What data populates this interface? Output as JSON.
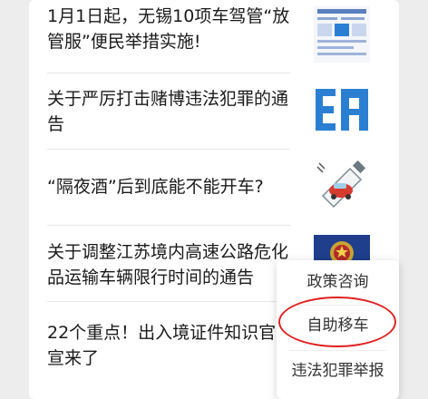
{
  "articles": [
    {
      "title": "1月1日起，无锡10项车驾管“放管服”便民举措实施!",
      "thumb": "doc-thumbnail"
    },
    {
      "title": "关于严厉打击赌博违法犯罪的通告",
      "thumb": "notice-thumbnail"
    },
    {
      "title": "“隔夜酒”后到底能不能开车?",
      "thumb": "car-cartoon-thumbnail"
    },
    {
      "title": "关于调整江苏境内高速公路危化品运输车辆限行时间的通告",
      "thumb": "police-badge-thumbnail"
    },
    {
      "title": "22个重点！出入境证件知识官宣来了",
      "thumb": ""
    }
  ],
  "menu": {
    "items": [
      "政策咨询",
      "自助移车",
      "违法犯罪举报"
    ],
    "highlighted_index": 1
  },
  "colors": {
    "highlight_circle": "#e02020",
    "thumb_blue": "#2b7fd3"
  }
}
